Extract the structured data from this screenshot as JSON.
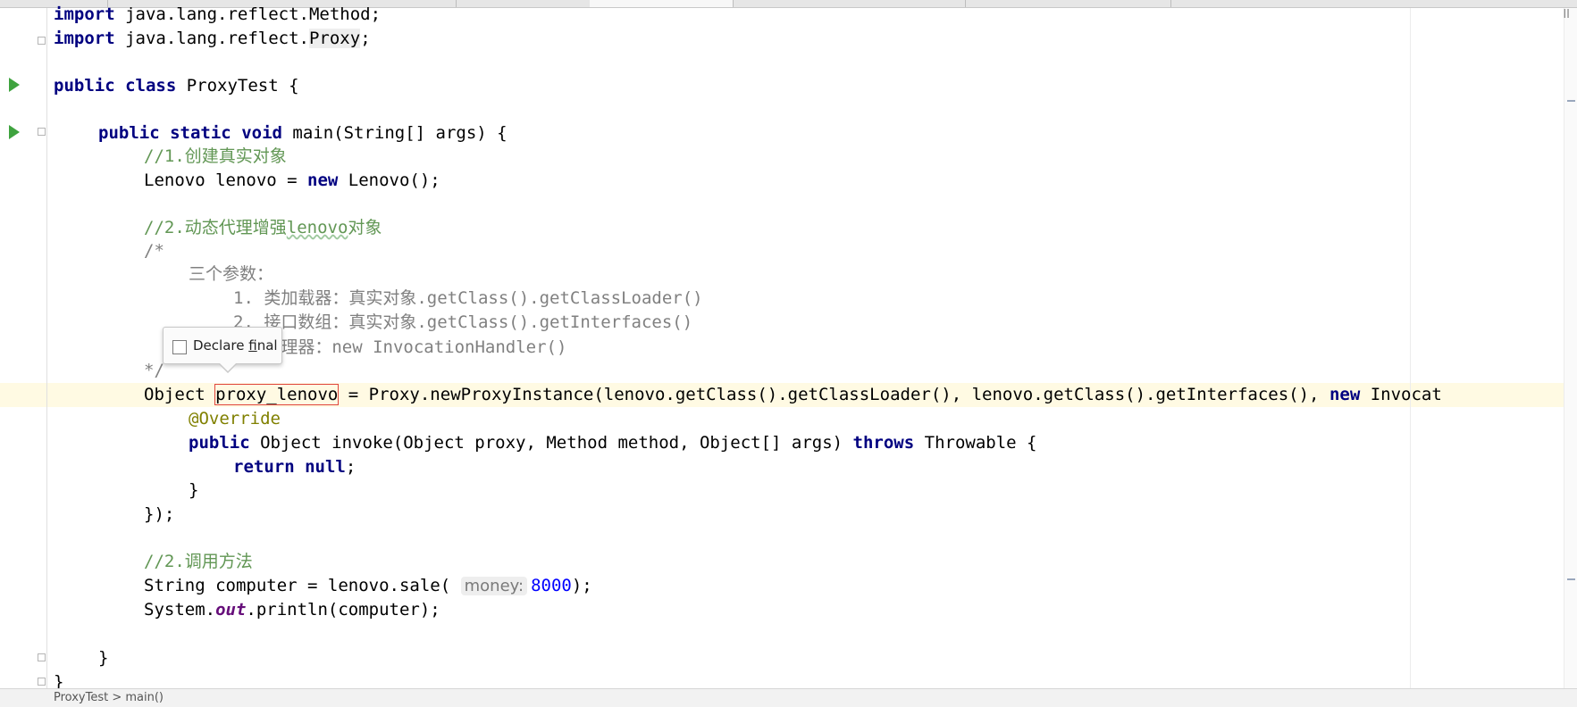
{
  "editor": {
    "lines": {
      "import_method": {
        "kw": "import",
        "rest": " java.lang.reflect.Method;"
      },
      "import_proxy": {
        "kw": "import",
        "pkg": " java.lang.reflect.",
        "cls": "Proxy",
        "end": ";"
      },
      "class_decl": {
        "kw1": "public",
        "kw2": "class",
        "rest": " ProxyTest {"
      },
      "main_decl": {
        "kw1": "public",
        "kw2": "static",
        "kw3": "void",
        "rest": " main(String[] args) {"
      },
      "comment1": "//1.创建真实对象",
      "lenovo_decl": {
        "a": "Lenovo lenovo = ",
        "kw": "new",
        "b": " Lenovo();"
      },
      "comment2": {
        "a": "//2.动态代理增强",
        "word": "lenovo",
        "b": "对象"
      },
      "block_open": "/*",
      "block_l1": "三个参数：",
      "block_l2": "1. 类加载器：真实对象.getClass().getClassLoader()",
      "block_l3": "2. 接口数组：真实对象.getClass().getInterfaces()",
      "block_l4": "3. 处理器：new InvocationHandler()",
      "block_close": "*/",
      "proxy_line": {
        "a": "Object ",
        "var": "proxy_lenovo",
        "b": " = Proxy.newProxyInstance(lenovo.getClass().getClassLoader(), lenovo.getClass().getInterfaces(), ",
        "kw": "new",
        "c": " Invocat"
      },
      "override": "@Override",
      "invoke_decl": {
        "kw1": "public",
        "a": " Object invoke(Object proxy, Method method, Object[] args) ",
        "kw2": "throws",
        "b": " Throwable {"
      },
      "return_line": {
        "kw1": "return",
        "kw2": "null",
        "end": ";"
      },
      "close_brace": "}",
      "close_call": "});",
      "comment3": "//2.调用方法",
      "sale_line": {
        "a": "String computer = lenovo.sale(",
        "hint": "money:",
        "num": "8000",
        "b": ");"
      },
      "println_line": {
        "a": "System.",
        "field": "out",
        "b": ".println(computer);"
      },
      "main_close": "}",
      "class_close": "}"
    }
  },
  "tooltip": {
    "label_prefix": "Declare ",
    "label_mnemonic": "f",
    "label_suffix": "inal"
  },
  "status": {
    "text": "ProxyTest > main()"
  },
  "colors": {
    "keyword": "#000080",
    "comment_line": "#629755",
    "comment_block": "#808080",
    "number": "#0000ff",
    "run_arrow": "#3fa33f",
    "highlight_row": "#fffae3",
    "rename_box": "#e0463c"
  }
}
